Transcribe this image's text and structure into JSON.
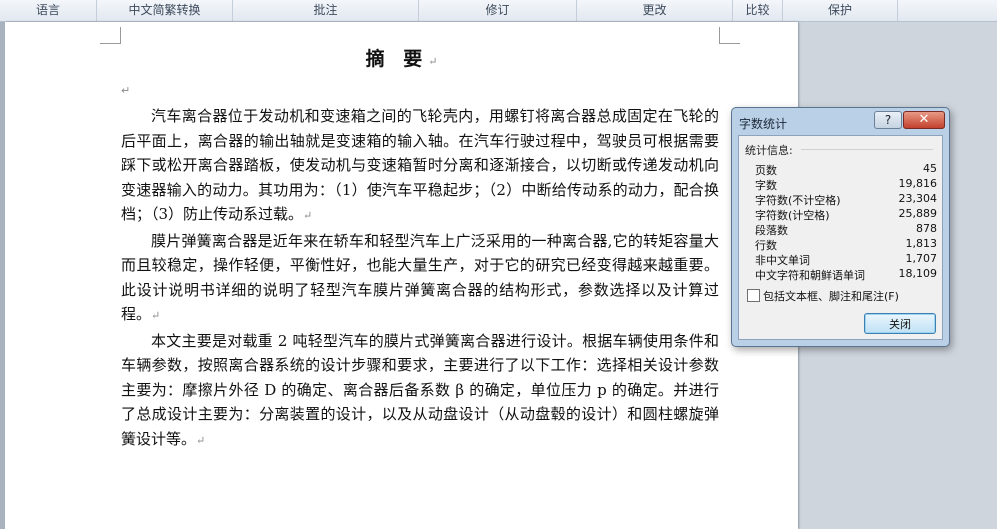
{
  "ribbon": {
    "groups": [
      "语言",
      "中文简繁转换",
      "批注",
      "修订",
      "更改",
      "比较",
      "保护"
    ]
  },
  "document": {
    "title": "摘 要",
    "paragraph_mark": "↵",
    "paragraphs": [
      "汽车离合器位于发动机和变速箱之间的飞轮壳内，用螺钉将离合器总成固定在飞轮的后平面上，离合器的输出轴就是变速箱的输入轴。在汽车行驶过程中，驾驶员可根据需要踩下或松开离合器踏板，使发动机与变速箱暂时分离和逐渐接合，以切断或传递发动机向变速器输入的动力。其功用为：（1）使汽车平稳起步；（2）中断给传动系的动力，配合换档；（3）防止传动系过载。",
      "膜片弹簧离合器是近年来在轿车和轻型汽车上广泛采用的一种离合器,它的转矩容量大而且较稳定，操作轻便，平衡性好，也能大量生产，对于它的研究已经变得越来越重要。此设计说明书详细的说明了轻型汽车膜片弹簧离合器的结构形式，参数选择以及计算过程。",
      "本文主要是对载重 2 吨轻型汽车的膜片式弹簧离合器进行设计。根据车辆使用条件和车辆参数，按照离合器系统的设计步骤和要求，主要进行了以下工作：选择相关设计参数主要为：摩擦片外径 D 的确定、离合器后备系数 β 的确定，单位压力 p 的确定。并进行了总成设计主要为：分离装置的设计，以及从动盘设计（从动盘毂的设计）和圆柱螺旋弹簧设计等。"
    ]
  },
  "dialog": {
    "title": "字数统计",
    "help_label": "?",
    "close_label": "✕",
    "stats_header": "统计信息:",
    "stats": [
      {
        "label": "页数",
        "value": "45"
      },
      {
        "label": "字数",
        "value": "19,816"
      },
      {
        "label": "字符数(不计空格)",
        "value": "23,304"
      },
      {
        "label": "字符数(计空格)",
        "value": "25,889"
      },
      {
        "label": "段落数",
        "value": "878"
      },
      {
        "label": "行数",
        "value": "1,813"
      },
      {
        "label": "非中文单词",
        "value": "1,707"
      },
      {
        "label": "中文字符和朝鲜语单词",
        "value": "18,109"
      }
    ],
    "checkbox_label": "包括文本框、脚注和尾注(F)",
    "checkbox_checked": false,
    "button_label": "关闭"
  }
}
